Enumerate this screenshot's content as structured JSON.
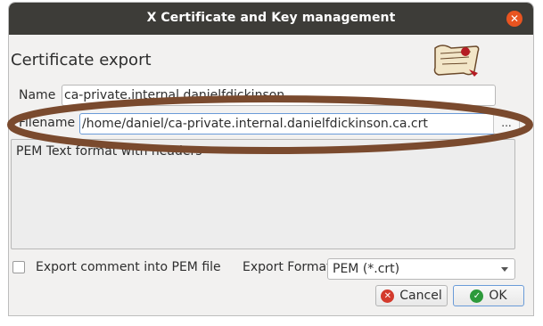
{
  "window": {
    "title": "X Certificate and Key management",
    "close_glyph": "✕"
  },
  "heading": "Certificate export",
  "fields": {
    "name_label": "Name",
    "name_value": "ca-private.internal.danielfdickinson",
    "filename_label": "Filename",
    "filename_value": "/home/daniel/ca-private.internal.danielfdickinson.ca.crt",
    "browse_label": "..."
  },
  "description": "PEM Text format with headers",
  "export_comment_label": "Export comment into PEM file",
  "export_format": {
    "label": "Export Format",
    "value": "PEM (*.crt)"
  },
  "buttons": {
    "cancel": "Cancel",
    "ok": "OK"
  },
  "colors": {
    "titlebar": "#3d3c38",
    "close": "#e95420",
    "annotation": "#7a4a2e"
  },
  "icons": [
    "close-icon",
    "logo-scroll-icon",
    "cancel-icon",
    "ok-check-icon",
    "dropdown-arrow-icon"
  ]
}
